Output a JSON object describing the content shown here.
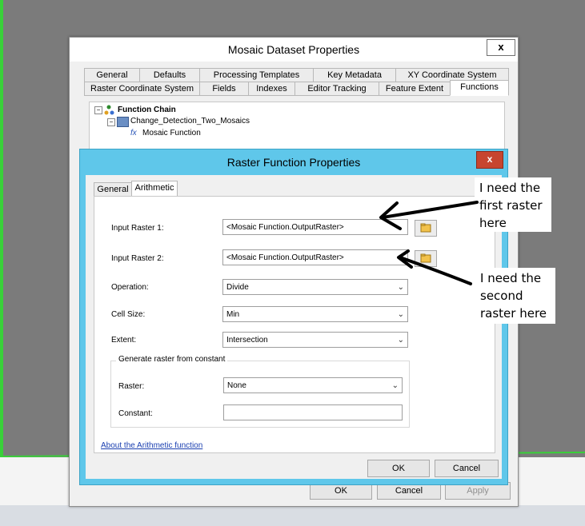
{
  "outer_dialog": {
    "title": "Mosaic Dataset Properties",
    "close_label": "x",
    "tabs_row1": [
      "General",
      "Defaults",
      "Processing Templates",
      "Key Metadata",
      "XY Coordinate System"
    ],
    "tabs_row2": [
      "Raster Coordinate System",
      "Fields",
      "Indexes",
      "Editor Tracking",
      "Feature Extent",
      "Functions"
    ],
    "active_tab": "Functions",
    "tree": {
      "root": "Function Chain",
      "child": "Change_Detection_Two_Mosaics",
      "leaf": "Mosaic Function",
      "leaf_icon": "fx"
    },
    "buttons": {
      "ok": "OK",
      "cancel": "Cancel",
      "apply": "Apply"
    }
  },
  "inner_dialog": {
    "title": "Raster Function Properties",
    "close_label": "x",
    "tabs": [
      "General",
      "Arithmetic"
    ],
    "active_tab": "Arithmetic",
    "input_raster_1": {
      "label": "Input Raster 1:",
      "value": "<Mosaic Function.OutputRaster>"
    },
    "input_raster_2": {
      "label": "Input Raster 2:",
      "value": "<Mosaic Function.OutputRaster>"
    },
    "operation": {
      "label": "Operation:",
      "value": "Divide"
    },
    "cell_size": {
      "label": "Cell Size:",
      "value": "Min"
    },
    "extent": {
      "label": "Extent:",
      "value": "Intersection"
    },
    "constant_group": {
      "title": "Generate raster from constant",
      "raster": {
        "label": "Raster:",
        "value": "None"
      },
      "constant": {
        "label": "Constant:",
        "value": ""
      }
    },
    "help_link": "About the Arithmetic function",
    "buttons": {
      "ok": "OK",
      "cancel": "Cancel"
    }
  },
  "annotations": {
    "note1": "I need the first raster here",
    "note2": "I need the second raster here"
  },
  "colors": {
    "inner_title_bg": "#5fc7ea",
    "close_red": "#c7452f",
    "link": "#1a3fb0"
  }
}
